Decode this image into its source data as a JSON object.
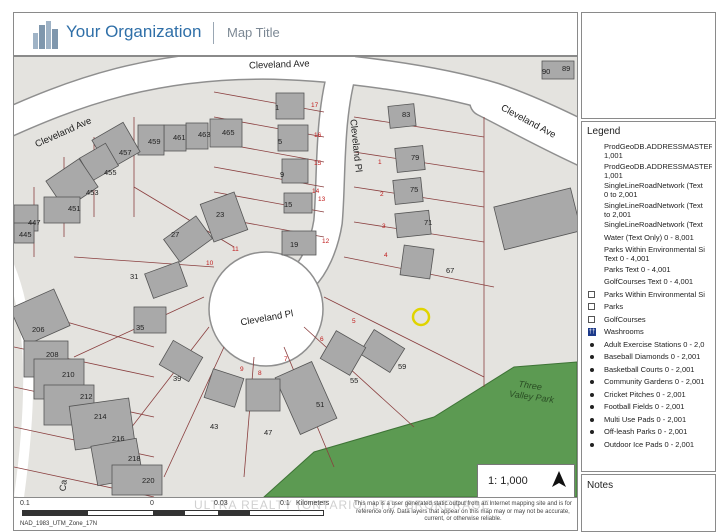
{
  "header": {
    "organization": "Your Organization",
    "map_title": "Map Title"
  },
  "map": {
    "streets": [
      "Cleveland Ave",
      "Cleveland Ave",
      "Cleveland Pl",
      "Cleveland Pl",
      "Cleveland Ave"
    ],
    "park": "Three Valley Park",
    "building_numbers": [
      "90",
      "89",
      "83",
      "79",
      "75",
      "71",
      "67",
      "59",
      "55",
      "51",
      "47",
      "43",
      "39",
      "35",
      "31",
      "27",
      "23",
      "19",
      "15",
      "9",
      "5",
      "1",
      "465",
      "463",
      "461",
      "459",
      "457",
      "455",
      "453",
      "451",
      "447",
      "445",
      "206",
      "208",
      "210",
      "212",
      "214",
      "216",
      "218",
      "220"
    ],
    "lot_numbers": [
      "17",
      "16",
      "15",
      "14",
      "13",
      "12",
      "11",
      "10",
      "9",
      "8",
      "7",
      "6",
      "5",
      "4",
      "3",
      "2",
      "1"
    ],
    "partial_label": "Ca",
    "scale": "1: 1,000",
    "north_arrow": "north-arrow-icon"
  },
  "footer": {
    "scale_labels": [
      "0.1",
      "0",
      "0.03",
      "0.1",
      "Kilometers"
    ],
    "projection": "NAD_1983_UTM_Zone_17N",
    "disclaimer": "This map is a user generated static output from an Internet mapping site and is for reference only. Data layers that appear on this map may or may not be accurate, current, or otherwise reliable.",
    "watermark": "ULTRA REALTY (ONTARIO) LTD. BROKERAGE"
  },
  "legend": {
    "title": "Legend",
    "items": [
      {
        "label": "ProdGeoDB.ADDRESSMASTER",
        "sublabel": "1,001",
        "swatch": "none"
      },
      {
        "label": "ProdGeoDB.ADDRESSMASTER",
        "sublabel": "1,001",
        "swatch": "none"
      },
      {
        "label": "SingleLineRoadNetwork (Text",
        "sublabel": "0 to 2,001",
        "swatch": "none"
      },
      {
        "label": "SingleLineRoadNetwork (Text",
        "sublabel": "to 2,001",
        "swatch": "none"
      },
      {
        "label": "SingleLineRoadNetwork (Text",
        "sublabel": "",
        "swatch": "none"
      },
      {
        "label": "Water (Text Only) 0 - 8,001",
        "sublabel": "",
        "swatch": "none"
      },
      {
        "label": "Parks Within Environmental Si",
        "sublabel": "Text  0 - 4,001",
        "swatch": "none"
      },
      {
        "label": "Parks Text  0 - 4,001",
        "sublabel": "",
        "swatch": "none"
      },
      {
        "label": "GolfCourses Text  0 - 4,001",
        "sublabel": "",
        "swatch": "none"
      },
      {
        "label": "Parks Within Environmental Si",
        "sublabel": "",
        "swatch": "box"
      },
      {
        "label": "Parks",
        "sublabel": "",
        "swatch": "box"
      },
      {
        "label": "GolfCourses",
        "sublabel": "",
        "swatch": "box"
      },
      {
        "label": "Washrooms",
        "sublabel": "",
        "swatch": "washroom"
      },
      {
        "label": "Adult Exercise Stations 0 - 2,0",
        "sublabel": "",
        "swatch": "dot"
      },
      {
        "label": "Baseball Diamonds 0 - 2,001",
        "sublabel": "",
        "swatch": "dot"
      },
      {
        "label": "Basketball Courts 0 - 2,001",
        "sublabel": "",
        "swatch": "dot"
      },
      {
        "label": "Community Gardens 0 - 2,001",
        "sublabel": "",
        "swatch": "dot"
      },
      {
        "label": "Cricket Pitches 0 - 2,001",
        "sublabel": "",
        "swatch": "dot"
      },
      {
        "label": "Football Fields 0 - 2,001",
        "sublabel": "",
        "swatch": "dot"
      },
      {
        "label": "Multi Use Pads 0 - 2,001",
        "sublabel": "",
        "swatch": "dot"
      },
      {
        "label": "Off-leash Parks 0 - 2,001",
        "sublabel": "",
        "swatch": "dot"
      },
      {
        "label": "Outdoor Ice Pads 0 - 2,001",
        "sublabel": "",
        "swatch": "dot"
      }
    ]
  },
  "notes": {
    "title": "Notes"
  },
  "colors": {
    "road": "#ffffff",
    "ground": "#e4e3df",
    "building": "#a9a9a9",
    "building_outline": "#555555",
    "park": "#5c9a52",
    "parcel_line": "#8a3f3f",
    "brand_blue": "#2f6fa8",
    "highlight": "#e0d400"
  }
}
